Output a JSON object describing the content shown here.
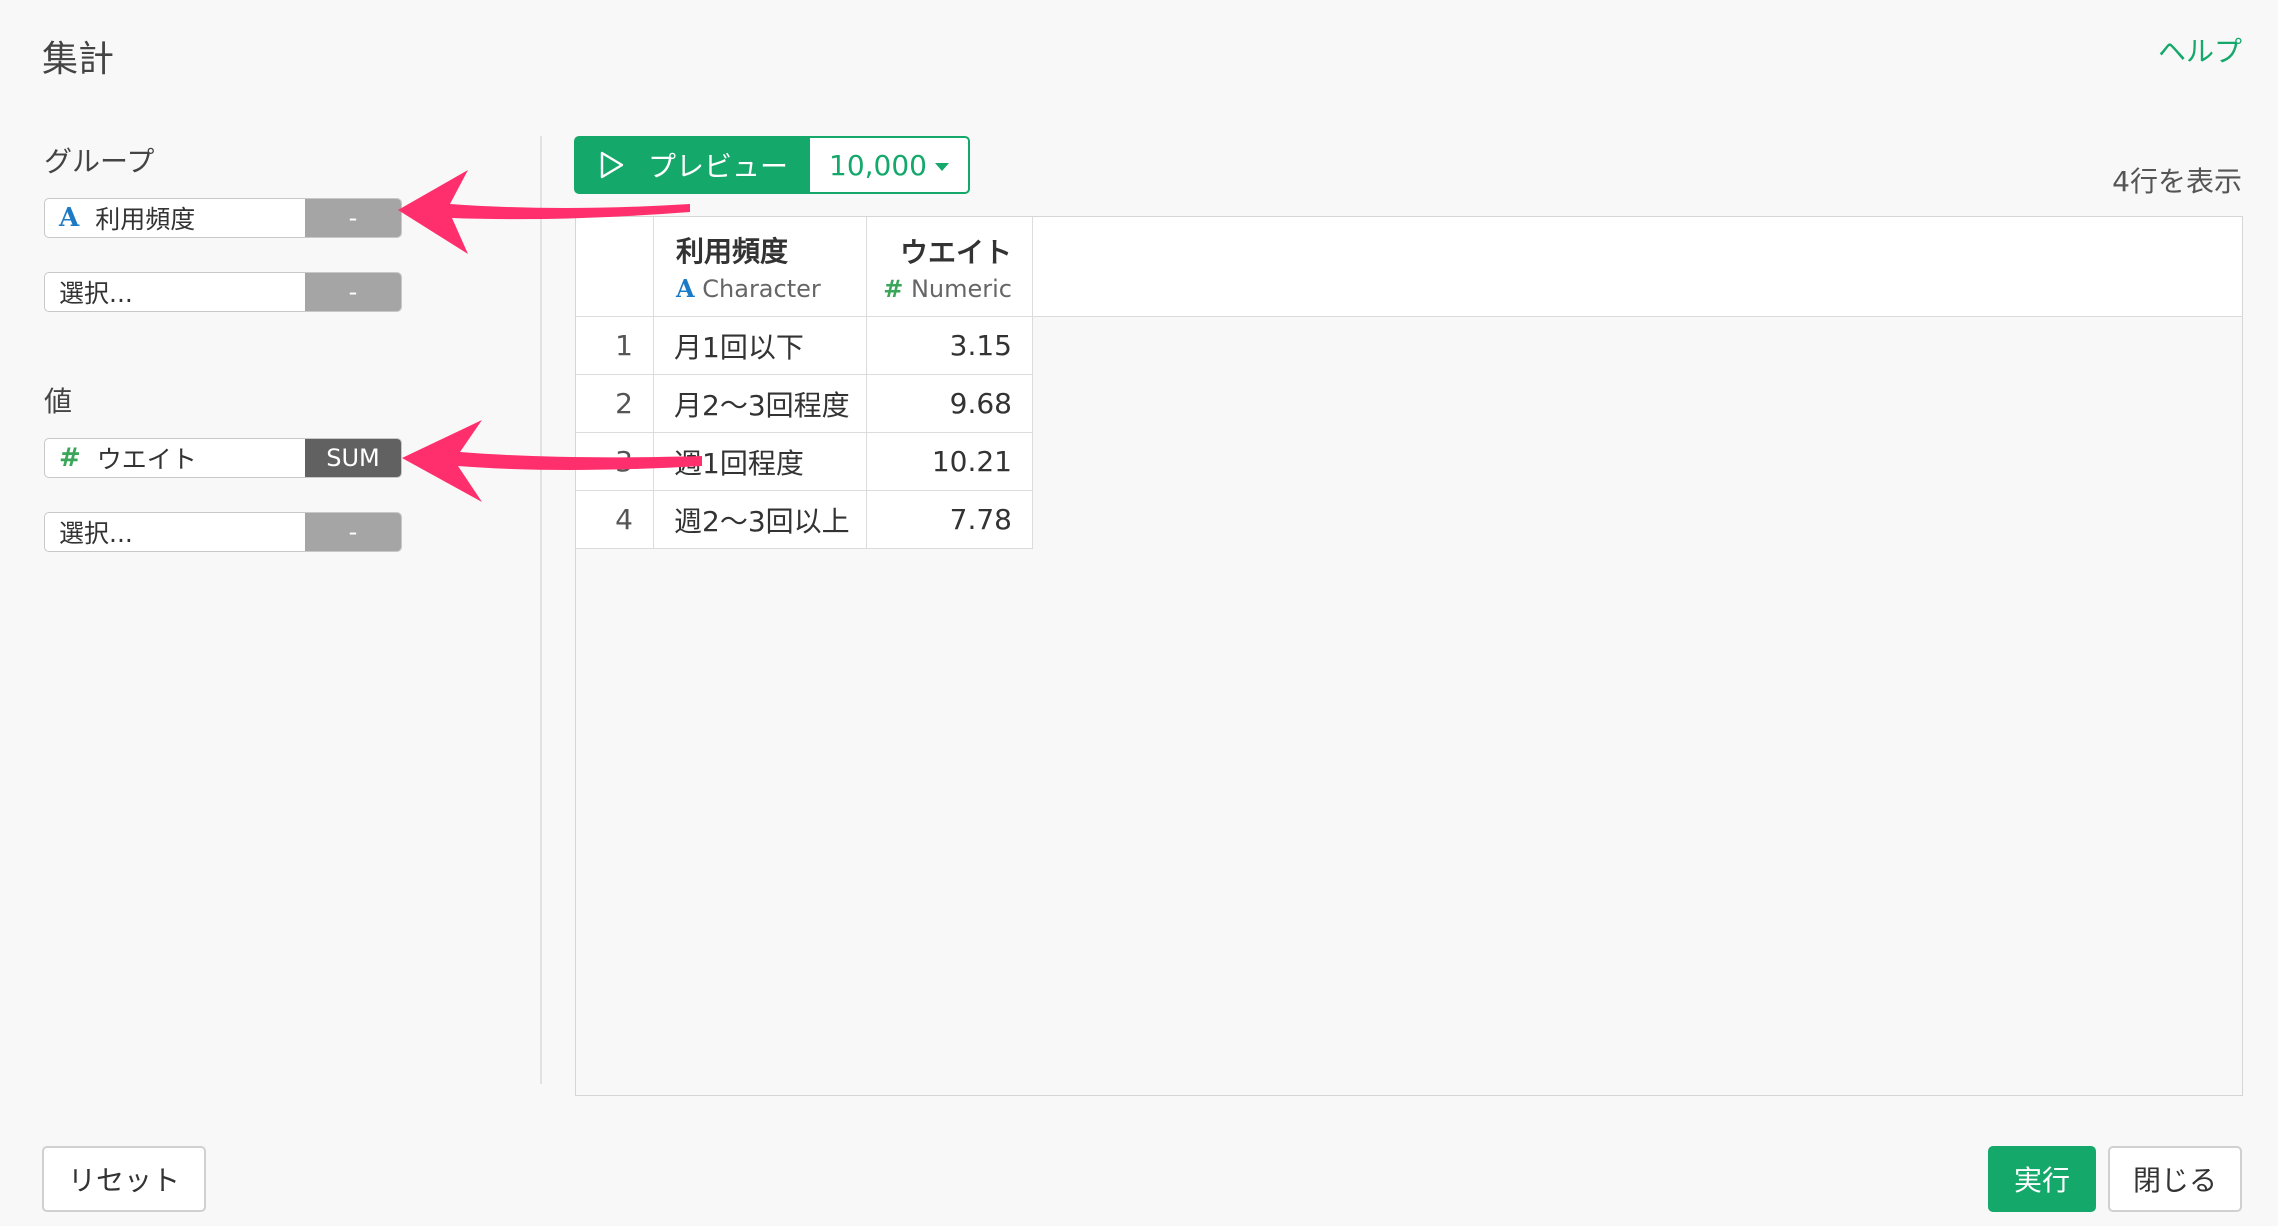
{
  "dialog": {
    "title": "集計",
    "help": "ヘルプ"
  },
  "group": {
    "label": "グループ",
    "fields": [
      {
        "type": "A",
        "name": "利用頻度",
        "fn": "-"
      },
      {
        "name": "選択...",
        "fn": "-"
      }
    ]
  },
  "value": {
    "label": "値",
    "fields": [
      {
        "type": "#",
        "name": "ウエイト",
        "fn": "SUM"
      },
      {
        "name": "選択...",
        "fn": "-"
      }
    ]
  },
  "toolbar": {
    "preview": "プレビュー",
    "rows": "10,000",
    "row_count": "4行を表示"
  },
  "table": {
    "columns": [
      {
        "name": "利用頻度",
        "type_icon": "A",
        "type": "Character"
      },
      {
        "name": "ウエイト",
        "type_icon": "#",
        "type": "Numeric"
      }
    ],
    "rows": [
      {
        "idx": "1",
        "freq": "月1回以下",
        "weight": "3.15"
      },
      {
        "idx": "2",
        "freq": "月2〜3回程度",
        "weight": "9.68"
      },
      {
        "idx": "3",
        "freq": "週1回程度",
        "weight": "10.21"
      },
      {
        "idx": "4",
        "freq": "週2〜3回以上",
        "weight": "7.78"
      }
    ]
  },
  "footer": {
    "reset": "リセット",
    "run": "実行",
    "close": "閉じる"
  },
  "colors": {
    "accent": "#14a86b",
    "annotation_arrow": "#ff2e6c"
  }
}
